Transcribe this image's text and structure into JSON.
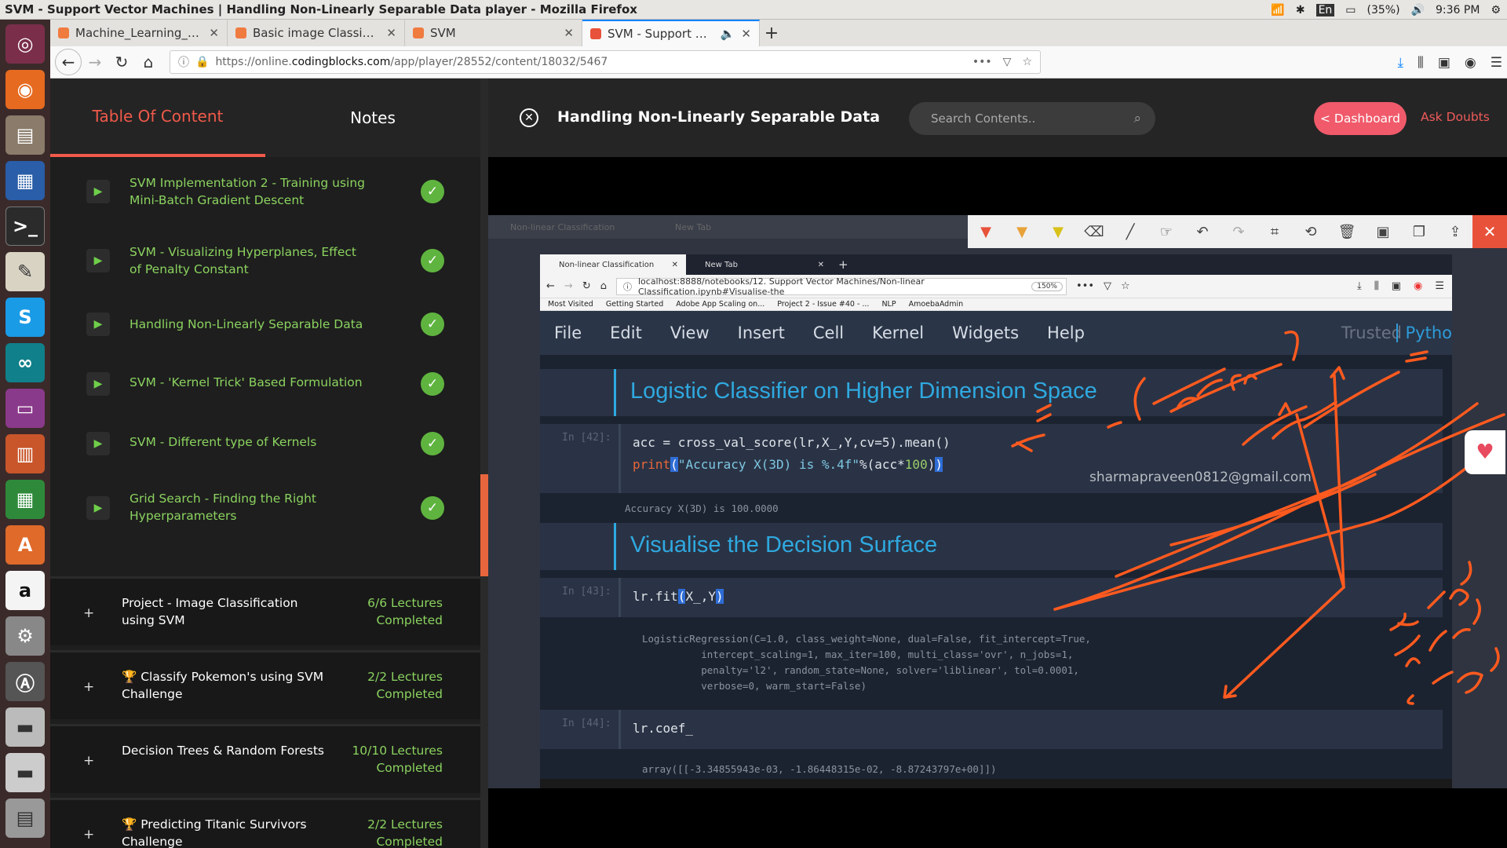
{
  "os_panel": {
    "window_title": "SVM - Support Vector Machines | Handling Non-Linearly Separable Data player - Mozilla Firefox",
    "keyboard": "En",
    "battery": "(35%)",
    "time": "9:36 PM"
  },
  "browser": {
    "tabs": [
      {
        "label": "Machine_Learning_2019/"
      },
      {
        "label": "Basic image Classification"
      },
      {
        "label": "SVM"
      },
      {
        "label": "SVM - Support Vector"
      }
    ],
    "url_prefix": "https://online.",
    "url_host": "codingblocks.com",
    "url_path": "/app/player/28552/content/18032/5467"
  },
  "sidebar": {
    "tab_toc": "Table Of Content",
    "tab_notes": "Notes",
    "lessons": [
      {
        "title": "SVM Implementation 2 - Training using Mini-Batch Gradient Descent"
      },
      {
        "title": "SVM - Visualizing Hyperplanes, Effect of Penalty Constant"
      },
      {
        "title": "Handling Non-Linearly Separable Data"
      },
      {
        "title": "SVM - 'Kernel Trick' Based Formulation"
      },
      {
        "title": "SVM - Different type of Kernels"
      },
      {
        "title": "Grid Search - Finding the Right Hyperparameters"
      }
    ],
    "sections": [
      {
        "title": "Project - Image Classification using SVM",
        "count": "6/6 Lectures Completed"
      },
      {
        "title": "🏆 Classify Pokemon's using SVM Challenge",
        "count": "2/2 Lectures Completed"
      },
      {
        "title": "Decision Trees & Random Forests",
        "count": "10/10 Lectures Completed"
      },
      {
        "title": "🏆 Predicting Titanic Survivors Challenge",
        "count": "2/2 Lectures Completed"
      }
    ]
  },
  "header": {
    "lecture_title": "Handling Non-Linearly Separable Data",
    "search_placeholder": "Search Contents..",
    "dashboard_label": "< Dashboard",
    "ask_label": "Ask Doubts"
  },
  "video": {
    "bg_tab1": "Non-linear Classification",
    "bg_tab2": "New Tab",
    "inner_tab1": "Non-linear Classification",
    "inner_tab2": "New Tab",
    "inner_url": "localhost:8888/notebooks/12. Support Vector Machines/Non-linear Classification.ipynb#Visualise-the",
    "inner_zoom": "150%",
    "bookmarks": [
      "Most Visited",
      "Getting Started",
      "Adobe App Scaling on...",
      "Project 2 - Issue #40 - ...",
      "NLP",
      "AmoebaAdmin"
    ],
    "menu": [
      "File",
      "Edit",
      "View",
      "Insert",
      "Cell",
      "Kernel",
      "Widgets",
      "Help"
    ],
    "trusted": "Trusted",
    "kernel": "Pytho",
    "heading1": "Logistic Classifier on Higher Dimension Space",
    "prompt42": "In [42]:",
    "code42_line1": "acc = cross_val_score(lr,X_,Y,cv=5).mean()",
    "out42": "Accuracy X(3D) is 100.0000",
    "heading2": "Visualise the Decision Surface",
    "prompt43": "In [43]:",
    "code43": "lr.fit(X_,Y)",
    "out43": "LogisticRegression(C=1.0, class_weight=None, dual=False, fit_intercept=True,\n          intercept_scaling=1, max_iter=100, multi_class='ovr', n_jobs=1,\n          penalty='l2', random_state=None, solver='liblinear', tol=0.0001,\n          verbose=0, warm_start=False)",
    "prompt44": "In [44]:",
    "code44": "lr.coef_",
    "out44": "array([[-3.34855943e-03, -1.86448315e-02, -8.87243797e+00]])",
    "email": "sharmapraveen0812@gmail.com"
  },
  "colors": {
    "accent": "#f05a4a",
    "lesson_green": "#8bd35f",
    "annotation": "#ff5a1f"
  }
}
